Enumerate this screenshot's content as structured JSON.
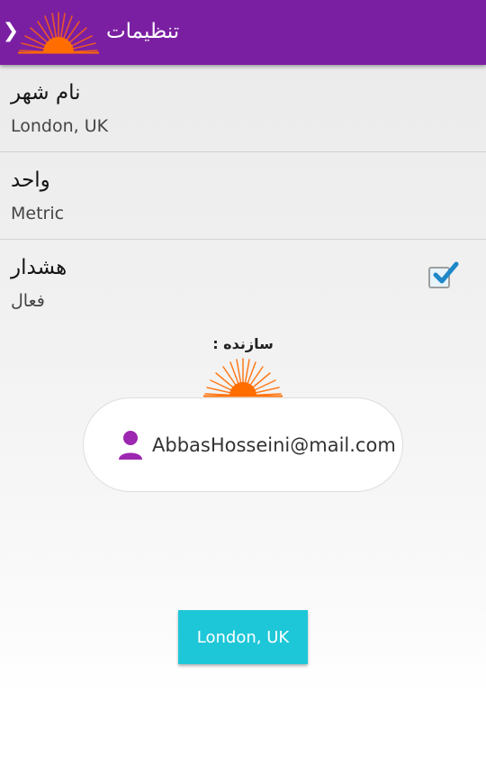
{
  "app_bar": {
    "title": "تنظیمات",
    "back_icon": "chevron-icon",
    "logo_icon": "sun-logo-icon",
    "background": "#7b1fa2"
  },
  "preferences": {
    "city": {
      "title": "نام شهر",
      "summary": "London, UK"
    },
    "unit": {
      "title": "واحد",
      "summary": "Metric"
    },
    "alert": {
      "title": "هشدار",
      "summary": "فعال",
      "checked": true
    }
  },
  "developer": {
    "label": "سازنده :",
    "logo_icon": "sun-logo-icon",
    "email": "AbbasHosseini@mail.com",
    "person_icon": "person-icon"
  },
  "city_button": {
    "label": "London, UK",
    "color": "#1ec7d8"
  },
  "colors": {
    "accent_purple": "#7b1fa2",
    "sun_orange": "#ff6d00",
    "icon_purple": "#9c27b0",
    "checkbox_blue": "#1e88c8"
  }
}
